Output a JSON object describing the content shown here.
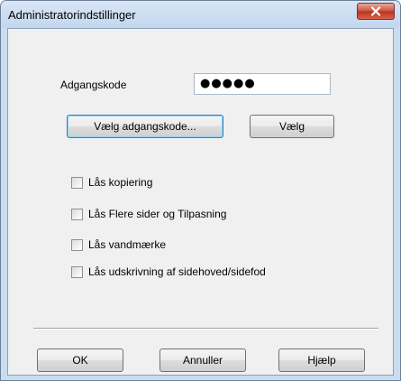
{
  "window": {
    "title": "Administratorindstillinger"
  },
  "password": {
    "label": "Adgangskode",
    "value": "●●●●●"
  },
  "buttons": {
    "choose_password": "Vælg adgangskode...",
    "choose": "Vælg",
    "ok": "OK",
    "cancel": "Annuller",
    "help": "Hjælp"
  },
  "options": [
    {
      "label": "Lås kopiering",
      "checked": false
    },
    {
      "label": "Lås Flere sider og Tilpasning",
      "checked": false
    },
    {
      "label": "Lås vandmærke",
      "checked": false
    },
    {
      "label": "Lås udskrivning af sidehoved/sidefod",
      "checked": false
    }
  ],
  "icons": {
    "close": "close-icon"
  }
}
